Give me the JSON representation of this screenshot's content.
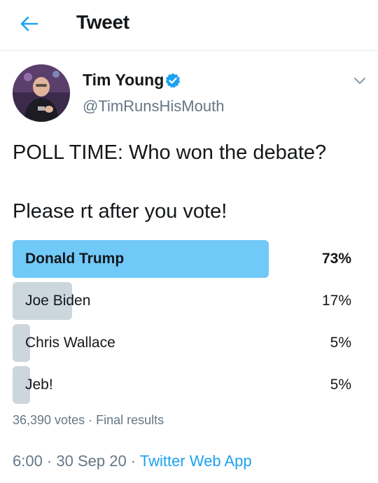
{
  "header": {
    "title": "Tweet",
    "back_icon": "arrow-left-icon"
  },
  "colors": {
    "accent": "#1da1f2",
    "winner_bar": "#71c9f8",
    "bar": "#ccd6dd",
    "muted": "#657786"
  },
  "author": {
    "name": "Tim Young",
    "handle": "@TimRunsHisMouth",
    "verified": true,
    "verified_icon": "verified-badge-icon",
    "menu_icon": "chevron-down-icon"
  },
  "tweet": {
    "text": "POLL TIME: Who won the debate?\n\nPlease rt after you vote!"
  },
  "poll": {
    "options": [
      {
        "label": "Donald Trump",
        "percent_label": "73%",
        "percent": 73,
        "winner": true
      },
      {
        "label": "Joe Biden",
        "percent_label": "17%",
        "percent": 17,
        "winner": false
      },
      {
        "label": "Chris Wallace",
        "percent_label": "5%",
        "percent": 5,
        "winner": false
      },
      {
        "label": "Jeb!",
        "percent_label": "5%",
        "percent": 5,
        "winner": false
      }
    ],
    "meta": "36,390 votes · Final results"
  },
  "footer": {
    "time_date": "6:00 · 30 Sep 20 · ",
    "source": "Twitter Web App"
  }
}
